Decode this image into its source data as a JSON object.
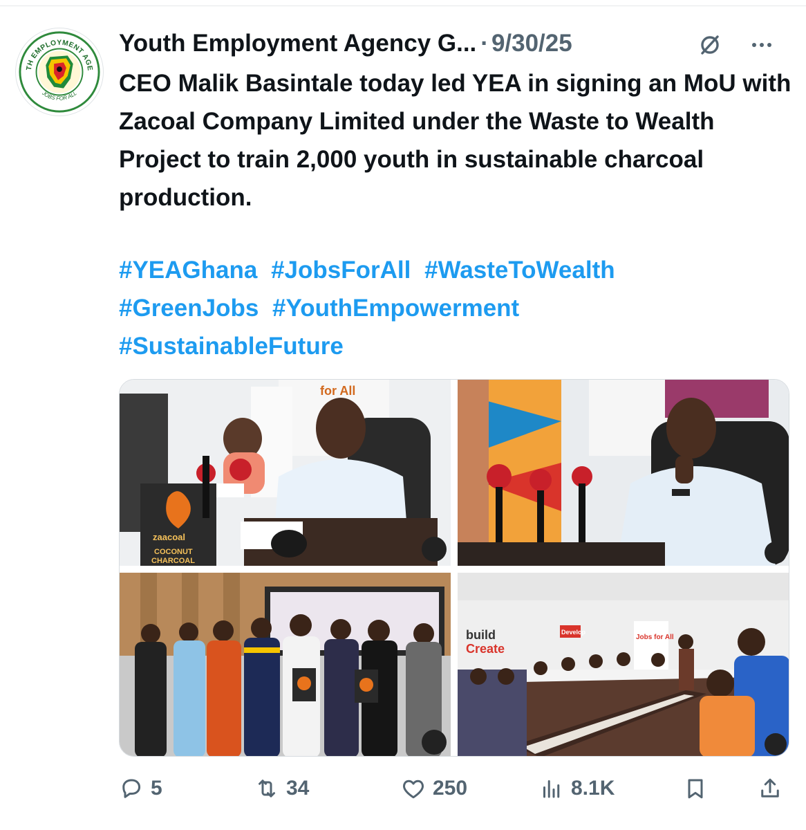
{
  "post": {
    "display_name": "Youth Employment Agency G...",
    "separator": "·",
    "date": "9/30/25",
    "body": "CEO Malik Basintale today led YEA in signing an MoU with Zacoal Company Limited under the Waste to Wealth Project to train 2,000 youth in sustainable charcoal production.",
    "hashtags": [
      "#YEAGhana",
      "#JobsForAll",
      "#WasteToWealth",
      "#GreenJobs",
      "#YouthEmpowerment",
      "#SustainableFuture"
    ]
  },
  "avatar": {
    "logo_text": "YOUTH EMPLOYMENT AGENCY",
    "logo_tagline": "JOBS FOR ALL",
    "colors": {
      "ring": "#2f8a3c",
      "red": "#d8232a",
      "yellow": "#f5c400",
      "green": "#1f8a3a"
    }
  },
  "media": {
    "photos": [
      {
        "scene_text": [
          "for All",
          "zaacoal",
          "COCONUT",
          "CHARCOAL"
        ]
      },
      {
        "scene_text": []
      },
      {
        "scene_text": []
      },
      {
        "scene_text": [
          "build",
          "Create",
          "Develop",
          "Jobs for All"
        ]
      }
    ]
  },
  "actions": {
    "reply_count": "5",
    "repost_count": "34",
    "like_count": "250",
    "views_count": "8.1K"
  },
  "icons": {
    "reply": "reply-icon",
    "repost": "repost-icon",
    "like": "heart-icon",
    "views": "views-icon",
    "bookmark": "bookmark-icon",
    "share": "share-icon",
    "grok": "grok-icon",
    "more": "more-icon"
  },
  "colors": {
    "text": "#0f1419",
    "muted": "#536471",
    "link": "#1d9bf0"
  }
}
